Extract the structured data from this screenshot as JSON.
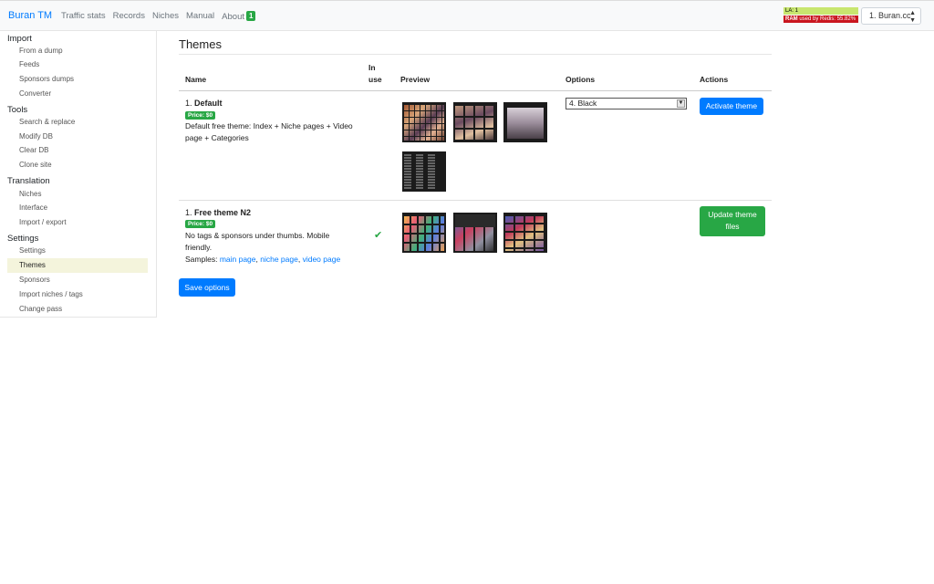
{
  "navbar": {
    "brand": "Buran TM",
    "links": [
      "Traffic stats",
      "Records",
      "Niches",
      "Manual",
      "About"
    ],
    "about_badge": "1",
    "stats": {
      "la": "LA: 1",
      "ram_label": "RAM",
      "ram_text": "used by Redis: 55.82%"
    },
    "site_select": "1. Buran.cc"
  },
  "sidebar": {
    "groups": [
      {
        "heading": "Import",
        "items": [
          "From a dump",
          "Feeds",
          "Sponsors dumps",
          "Converter"
        ]
      },
      {
        "heading": "Tools",
        "items": [
          "Search & replace",
          "Modify DB",
          "Clear DB",
          "Clone site"
        ]
      },
      {
        "heading": "Translation",
        "items": [
          "Niches",
          "Interface",
          "Import / export"
        ]
      },
      {
        "heading": "Settings",
        "items": [
          "Settings",
          "Themes",
          "Sponsors",
          "Import niches / tags",
          "Change pass"
        ]
      }
    ],
    "active_item": "Themes"
  },
  "main": {
    "title": "Themes",
    "headers": {
      "name": "Name",
      "in_use_1": "In",
      "in_use_2": "use",
      "preview": "Preview",
      "options": "Options",
      "actions": "Actions"
    },
    "themes": [
      {
        "number": "1.",
        "name": "Default",
        "price": "Price: $0",
        "desc_line1": "Default free theme: Index + Niche pages + Video",
        "desc_line2": "page + Categories",
        "option_selected": "4. Black",
        "action": "Activate theme"
      },
      {
        "number": "1.",
        "name": "Free theme N2",
        "price": "Price: $0",
        "desc_line1": "No tags & sponsors under thumbs. Mobile",
        "desc_line2": "friendly.",
        "samples_label": "Samples:",
        "sample_links": [
          "main page",
          "niche page",
          "video page"
        ],
        "action_line1": "Update theme",
        "action_line2": "files"
      }
    ],
    "save_button": "Save options"
  },
  "icons": {
    "in_use": "check-icon",
    "select_arrows": "sort-icon",
    "dropdown": "caret-down-icon"
  },
  "colors": {
    "primary": "#007bff",
    "success": "#28a745",
    "ram_bar": "#c9151e",
    "la_bar": "#c8e66f",
    "active_item": "#f4f4dc"
  }
}
